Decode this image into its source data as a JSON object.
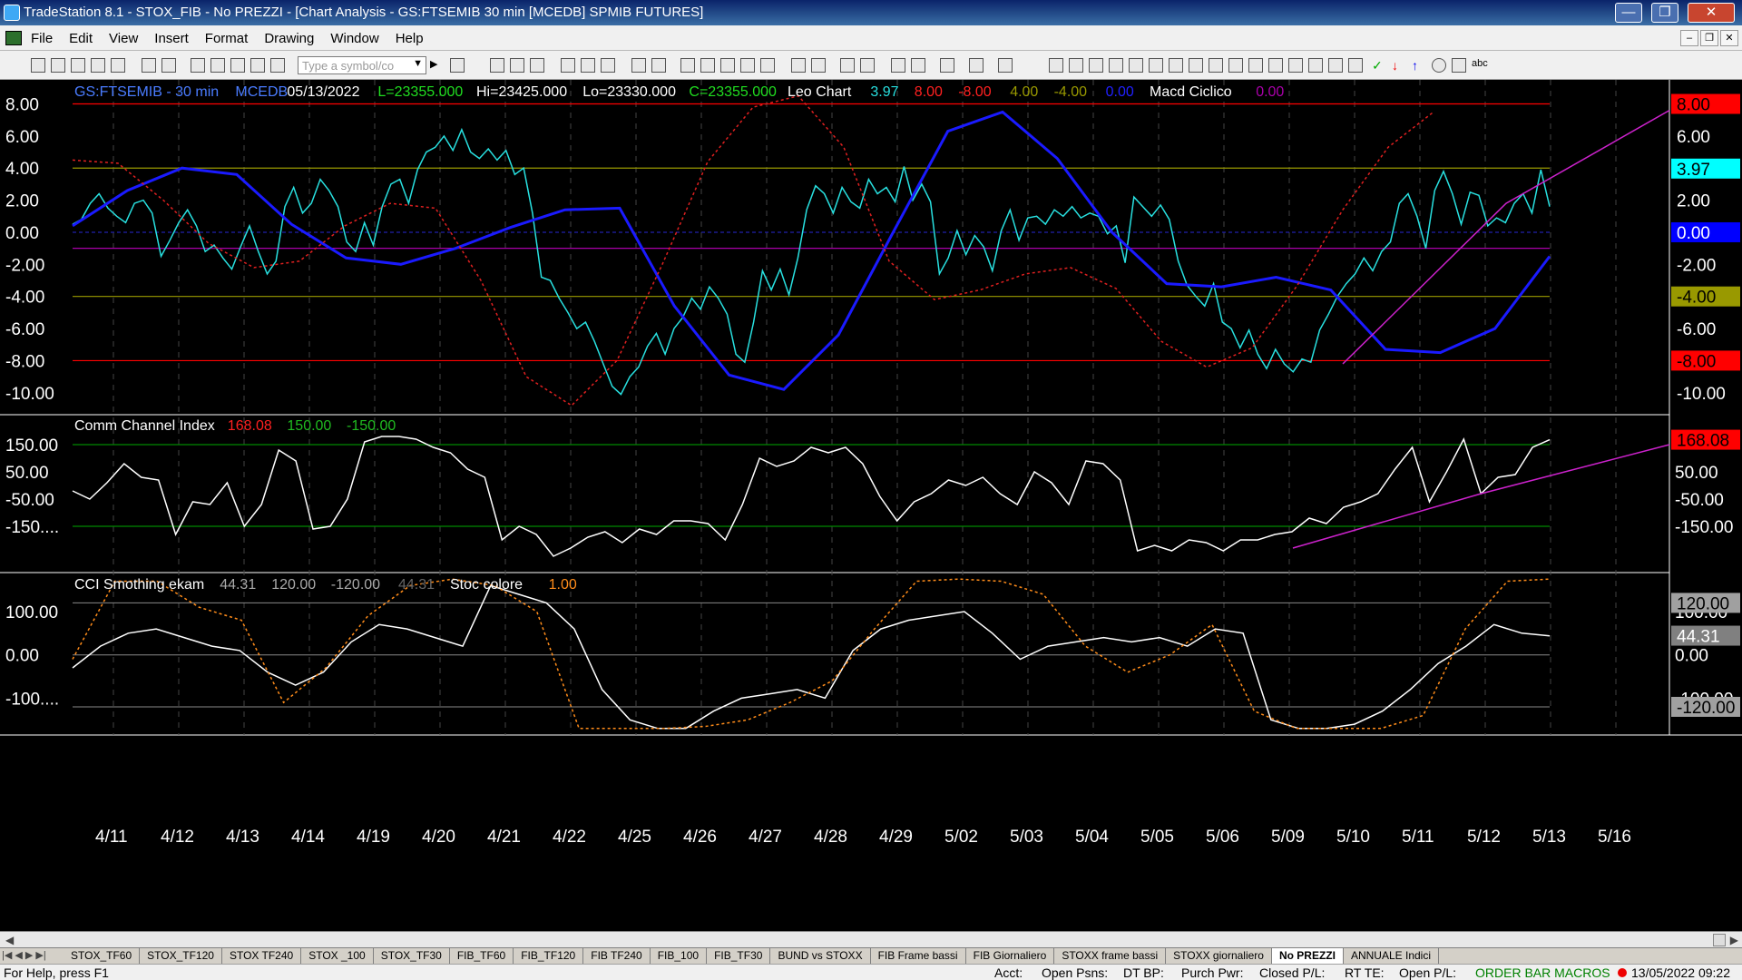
{
  "window": {
    "title": "TradeStation 8.1 - STOX_FIB - No PREZZI - [Chart Analysis - GS:FTSEMIB  30 min  [MCEDB] SPMIB FUTURES]",
    "minimize": "—",
    "restore": "❐",
    "close": "✕"
  },
  "menu": [
    "File",
    "Edit",
    "View",
    "Insert",
    "Format",
    "Drawing",
    "Window",
    "Help"
  ],
  "mdi": {
    "minimize": "–",
    "restore": "❐",
    "close": "✕"
  },
  "toolbar": {
    "symbol_placeholder": "Type a symbol/co",
    "text_tool": "abc"
  },
  "colors": {
    "price": "#28e0e0",
    "leo_solid": "#1a1aff",
    "leo_dotted": "#e02020",
    "red_level": "#ff0000",
    "olive_level": "#999900",
    "purple_level": "#aa00aa",
    "cci": "#ffffff",
    "cci_hi": "#00aa00",
    "trend": "#cc22cc",
    "stoc": "#ff8c1a",
    "gray": "#888888"
  },
  "pane1": {
    "header": [
      {
        "t": "GS:FTSEMIB - 30 min",
        "c": "#4a7cff"
      },
      {
        "t": "MCEDB",
        "c": "#4a7cff"
      },
      {
        "t": "05/13/2022",
        "c": "#ffffff"
      },
      {
        "t": "L=23355.000",
        "c": "#20dd20"
      },
      {
        "t": "Hi=23425.000",
        "c": "#ffffff"
      },
      {
        "t": "Lo=23330.000",
        "c": "#ffffff"
      },
      {
        "t": "C=23355.000",
        "c": "#20dd20"
      },
      {
        "t": "Leo Chart",
        "c": "#ffffff"
      },
      {
        "t": "3.97",
        "c": "#28e0e0"
      },
      {
        "t": "8.00",
        "c": "#ff2020"
      },
      {
        "t": "-8.00",
        "c": "#ff2020"
      },
      {
        "t": "4.00",
        "c": "#999900"
      },
      {
        "t": "-4.00",
        "c": "#999900"
      },
      {
        "t": "0.00",
        "c": "#2020ff"
      },
      {
        "t": "Macd Ciclico",
        "c": "#ffffff"
      },
      {
        "t": "0.00",
        "c": "#aa00aa"
      }
    ],
    "left_ticks": [
      "8.00",
      "6.00",
      "4.00",
      "2.00",
      "0.00",
      "-2.00",
      "-4.00",
      "-6.00",
      "-8.00",
      "-10.00"
    ],
    "right_ticks": [
      "6.00",
      "2.00",
      "-2.00",
      "-6.00",
      "-10.00"
    ],
    "right_badges": [
      {
        "t": "8.00",
        "v": 8,
        "bg": "#ff0000",
        "fg": "#000000"
      },
      {
        "t": "3.97",
        "v": 3.97,
        "bg": "#00ffff",
        "fg": "#000000"
      },
      {
        "t": "0.00",
        "v": 0,
        "bg": "#0000ff",
        "fg": "#ffffff"
      },
      {
        "t": "-4.00",
        "v": -4,
        "bg": "#999900",
        "fg": "#000000"
      },
      {
        "t": "-8.00",
        "v": -8,
        "bg": "#ff0000",
        "fg": "#000000"
      }
    ]
  },
  "pane2": {
    "header": [
      {
        "t": "Comm Channel Index",
        "c": "#ffffff"
      },
      {
        "t": "168.08",
        "c": "#ff2020"
      },
      {
        "t": "150.00",
        "c": "#20bb20"
      },
      {
        "t": "-150.00",
        "c": "#20bb20"
      }
    ],
    "left_ticks": [
      "150.00",
      "50.00",
      "-50.00",
      "-150...."
    ],
    "right_ticks": [
      "50.00",
      "-50.00",
      "-150.00"
    ],
    "right_badges": [
      {
        "t": "168.08",
        "v": 168.08,
        "bg": "#ff0000",
        "fg": "#000000"
      }
    ]
  },
  "pane3": {
    "header": [
      {
        "t": "CCI Smothing ekam",
        "c": "#ffffff"
      },
      {
        "t": "44.31",
        "c": "#aaaaaa"
      },
      {
        "t": "120.00",
        "c": "#aaaaaa"
      },
      {
        "t": "-120.00",
        "c": "#aaaaaa"
      },
      {
        "t": "44.31",
        "c": "#666666"
      },
      {
        "t": "Stoc colore",
        "c": "#ffffff"
      },
      {
        "t": "1.00",
        "c": "#ff8c1a"
      }
    ],
    "left_ticks": [
      "100.00",
      "0.00",
      "-100...."
    ],
    "right_ticks": [
      "100.00",
      "0.00",
      "-100.00"
    ],
    "right_badges": [
      {
        "t": "120.00",
        "v": 120,
        "bg": "#a0a0a0",
        "fg": "#000000"
      },
      {
        "t": "44.31",
        "v": 44.31,
        "bg": "#808080",
        "fg": "#ffffff"
      },
      {
        "t": "-120.00",
        "v": -120,
        "bg": "#a0a0a0",
        "fg": "#000000"
      }
    ]
  },
  "chart_data": {
    "type": "line",
    "x": [
      "4/11",
      "4/12",
      "4/13",
      "4/14",
      "4/19",
      "4/20",
      "4/21",
      "4/22",
      "4/25",
      "4/26",
      "4/27",
      "4/28",
      "4/29",
      "5/02",
      "5/03",
      "5/04",
      "5/05",
      "5/06",
      "5/09",
      "5/10",
      "5/11",
      "5/12",
      "5/13",
      "5/16"
    ],
    "levels": {
      "pane1": [
        8,
        4,
        0,
        -1,
        -4,
        -8
      ],
      "pane2": [
        150,
        -150
      ],
      "pane3": [
        120,
        0,
        -120
      ]
    },
    "series": [
      {
        "pane": 1,
        "style": "line",
        "color": "#28e0e0",
        "values": [
          0.5,
          0.8,
          1.8,
          2.4,
          1.5,
          1.0,
          0.6,
          1.8,
          2.0,
          1.2,
          -1.5,
          -0.5,
          0.6,
          1.4,
          0.4,
          -1.2,
          -0.8,
          -1.6,
          -2.3,
          -0.9,
          0.4,
          -1.2,
          -2.6,
          -1.8,
          1.6,
          2.8,
          1.2,
          1.8,
          3.3,
          2.6,
          1.6,
          -0.6,
          -1.2,
          0.6,
          -0.8,
          1.6,
          3.0,
          3.3,
          1.8,
          3.9,
          5.0,
          5.3,
          6.0,
          5.1,
          6.4,
          5.0,
          4.6,
          5.2,
          4.5,
          5.1,
          3.6,
          4.0,
          1.2,
          -2.8,
          -3.0,
          -4.1,
          -5.0,
          -6.0,
          -5.6,
          -6.8,
          -8.2,
          -9.6,
          -10.1,
          -9.0,
          -8.4,
          -7.1,
          -6.3,
          -7.6,
          -6.0,
          -5.3,
          -4.1,
          -4.8,
          -3.4,
          -4.1,
          -5.1,
          -7.6,
          -8.1,
          -5.6,
          -2.4,
          -3.6,
          -2.3,
          -3.9,
          -1.6,
          1.4,
          2.9,
          2.4,
          1.2,
          2.8,
          1.9,
          1.5,
          3.3,
          2.4,
          2.8,
          1.9,
          4.1,
          2.0,
          3.0,
          1.9,
          -2.6,
          -1.6,
          0.1,
          -1.4,
          -0.2,
          -0.9,
          -2.4,
          0.1,
          1.4,
          -0.5,
          0.9,
          1.0,
          0.5,
          1.4,
          1.0,
          1.6,
          0.9,
          1.2,
          1.0,
          -0.1,
          0.4,
          -1.9,
          2.2,
          1.6,
          1.0,
          1.7,
          0.8,
          -1.8,
          -3.3,
          -4.0,
          -4.6,
          -3.2,
          -5.6,
          -6.0,
          -7.2,
          -6.1,
          -7.6,
          -8.5,
          -7.3,
          -8.2,
          -8.7,
          -7.9,
          -8.1,
          -6.1,
          -5.1,
          -4.0,
          -3.2,
          -2.6,
          -1.6,
          -2.4,
          -1.2,
          -0.6,
          1.8,
          2.4,
          1.0,
          -1.0,
          2.6,
          3.8,
          2.4,
          0.5,
          2.5,
          2.3,
          0.4,
          0.9,
          0.6,
          1.8,
          2.4,
          1.2,
          3.9,
          1.6
        ]
      },
      {
        "pane": 1,
        "style": "line",
        "color": "#1a1aff",
        "values": [
          0.4,
          2.6,
          4.0,
          3.6,
          0.5,
          -1.6,
          -2.0,
          -1.0,
          0.3,
          1.4,
          1.5,
          -4.6,
          -8.9,
          -9.8,
          -6.4,
          0.0,
          6.3,
          7.5,
          4.6,
          0.0,
          -3.2,
          -3.4,
          -2.8,
          -3.6,
          -7.3,
          -7.5,
          -6.0,
          -1.5
        ]
      },
      {
        "pane": 1,
        "style": "dotted",
        "color": "#e02020",
        "values": [
          4.5,
          4.3,
          2.0,
          -0.7,
          -2.2,
          -1.8,
          0.4,
          1.8,
          1.5,
          -3.0,
          -9.0,
          -10.8,
          -8.0,
          -2.0,
          4.4,
          7.8,
          8.5,
          5.3,
          -1.8,
          -4.2,
          -3.6,
          -2.6,
          -2.2,
          -3.5,
          -6.8,
          -8.4,
          -7.2,
          -3.3,
          1.4,
          5.3,
          7.5
        ]
      },
      {
        "pane": 1,
        "style": "line",
        "color": "#cc22cc",
        "values": [
          -8.2,
          1.8,
          7.6
        ]
      },
      {
        "pane": 2,
        "style": "line",
        "color": "#ffffff",
        "values": [
          -20,
          -50,
          10,
          80,
          30,
          20,
          -180,
          -60,
          -70,
          10,
          -150,
          -70,
          130,
          90,
          -160,
          -150,
          -50,
          160,
          180,
          180,
          170,
          140,
          120,
          60,
          30,
          -200,
          -150,
          -180,
          -260,
          -230,
          -190,
          -170,
          -210,
          -160,
          -180,
          -130,
          -130,
          -140,
          -200,
          -70,
          100,
          70,
          90,
          140,
          120,
          140,
          80,
          -40,
          -130,
          -60,
          -30,
          20,
          0,
          30,
          -30,
          -70,
          50,
          10,
          -70,
          90,
          80,
          20,
          -240,
          -220,
          -240,
          -200,
          -210,
          -240,
          -200,
          -200,
          -180,
          -170,
          -120,
          -140,
          -80,
          -60,
          -30,
          60,
          140,
          -60,
          50,
          170,
          -30,
          30,
          40,
          140,
          168
        ]
      },
      {
        "pane": 2,
        "style": "line",
        "color": "#cc22cc",
        "values": [
          -230,
          -30,
          150
        ]
      },
      {
        "pane": 3,
        "style": "line",
        "color": "#ffffff",
        "values": [
          -30,
          20,
          50,
          60,
          40,
          20,
          10,
          -40,
          -70,
          -40,
          30,
          70,
          60,
          40,
          20,
          160,
          140,
          120,
          60,
          -80,
          -150,
          -170,
          -170,
          -130,
          -100,
          -90,
          -80,
          -100,
          10,
          60,
          80,
          90,
          100,
          50,
          -10,
          20,
          30,
          40,
          30,
          40,
          20,
          60,
          50,
          -150,
          -170,
          -170,
          -160,
          -130,
          -80,
          -20,
          20,
          70,
          50,
          44
        ]
      },
      {
        "pane": 3,
        "style": "dotted",
        "color": "#ff8c1a",
        "values": [
          -10,
          170,
          170,
          110,
          80,
          -110,
          -30,
          90,
          160,
          175,
          160,
          100,
          -170,
          -170,
          -170,
          -165,
          -150,
          -110,
          -60,
          60,
          170,
          175,
          170,
          140,
          20,
          -40,
          0,
          70,
          -130,
          -170,
          -170,
          -170,
          -140,
          60,
          170,
          175
        ]
      }
    ]
  }
}
